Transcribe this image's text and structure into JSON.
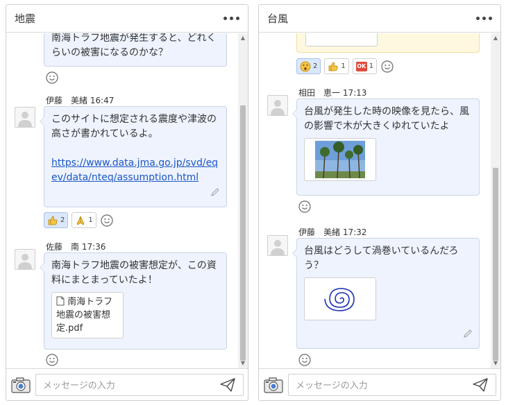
{
  "composer": {
    "placeholder": "メッセージの入力"
  },
  "left": {
    "title": "地震",
    "messages": [
      {
        "text": "南海トラフ地震が発生すると、どれくらいの被害になるのかな？"
      },
      {
        "author": "伊藤　美緒",
        "time": "16:47",
        "text": "このサイトに想定される震度や津波の高さが書かれているよ。",
        "link": "https://www.data.jma.go.jp/svd/eqev/data/nteq/assumption.html",
        "reactions": [
          {
            "icon": "thumbs-up",
            "count": "2"
          },
          {
            "icon": "praying-hands",
            "count": "1"
          }
        ]
      },
      {
        "author": "佐藤　南",
        "time": "17:36",
        "text": "南海トラフ地震の被害想定が、この資料にまとまっていたよ！",
        "file": "南海トラフ地震の被害想定.pdf"
      }
    ]
  },
  "right": {
    "title": "台風",
    "reactions_top": [
      {
        "icon": "surprised-face",
        "count": "2"
      },
      {
        "icon": "thumbs-up",
        "count": "1"
      },
      {
        "icon": "ok-button",
        "count": "1",
        "label": "OK"
      }
    ],
    "messages": [
      {
        "author": "相田　恵一",
        "time": "17:13",
        "text": "台風が発生した時の映像を見たら、風の影響で木が大きくゆれていたよ",
        "attachment": "palm-trees-photo"
      },
      {
        "author": "伊藤　美緒",
        "time": "17:32",
        "text": "台風はどうして渦巻いているんだろう？",
        "attachment": "spiral-drawing"
      }
    ]
  }
}
